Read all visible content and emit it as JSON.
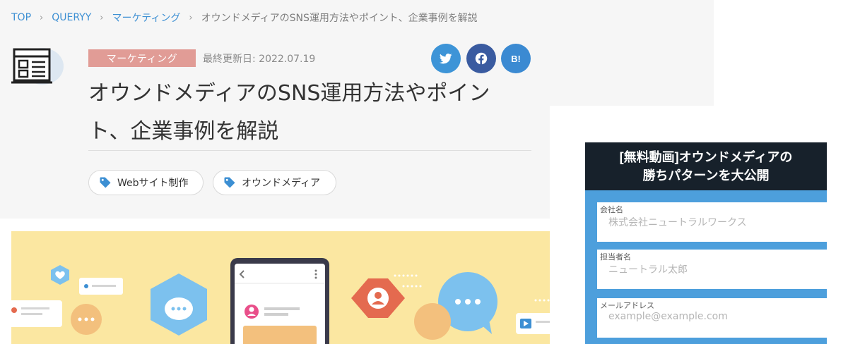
{
  "breadcrumb": {
    "items": [
      "TOP",
      "QUERYY",
      "マーケティング"
    ],
    "separator": "›",
    "current": "オウンドメディアのSNS運用方法やポイント、企業事例を解説"
  },
  "article": {
    "category_icon": "article-grid-icon",
    "category": "マーケティング",
    "updated": "最終更新日: 2022.07.19",
    "title": "オウンドメディアのSNS運用方法やポイント、企業事例を解説",
    "tags": [
      {
        "label": "Webサイト制作",
        "icon": "tag-icon"
      },
      {
        "label": "オウンドメディア",
        "icon": "tag-icon"
      }
    ]
  },
  "share": {
    "twitter_icon": "twitter-bird-icon",
    "facebook_icon": "facebook-icon",
    "hatena_label": "B!"
  },
  "hero": {
    "description_icons": [
      "heart-icon",
      "chat-bubble-icon",
      "smartphone-icon",
      "user-hexagon-icon",
      "play-icon"
    ]
  },
  "form": {
    "header_line1": "[無料動画]オウンドメディアの",
    "header_line2": "勝ちパターンを大公開",
    "fields": [
      {
        "label": "会社名",
        "placeholder": "株式会社ニュートラルワークス"
      },
      {
        "label": "担当者名",
        "placeholder": "ニュートラル太郎"
      },
      {
        "label": "メールアドレス",
        "placeholder": "example@example.com"
      }
    ]
  },
  "colors": {
    "link": "#3c8fd3",
    "category_badge": "#e19c96",
    "twitter": "#3d94d7",
    "facebook": "#3a5ba0",
    "hatena": "#3b8ad2",
    "form_header": "#17212b",
    "form_body": "#4d9fdc",
    "hero_background": "#fbe7a1"
  }
}
